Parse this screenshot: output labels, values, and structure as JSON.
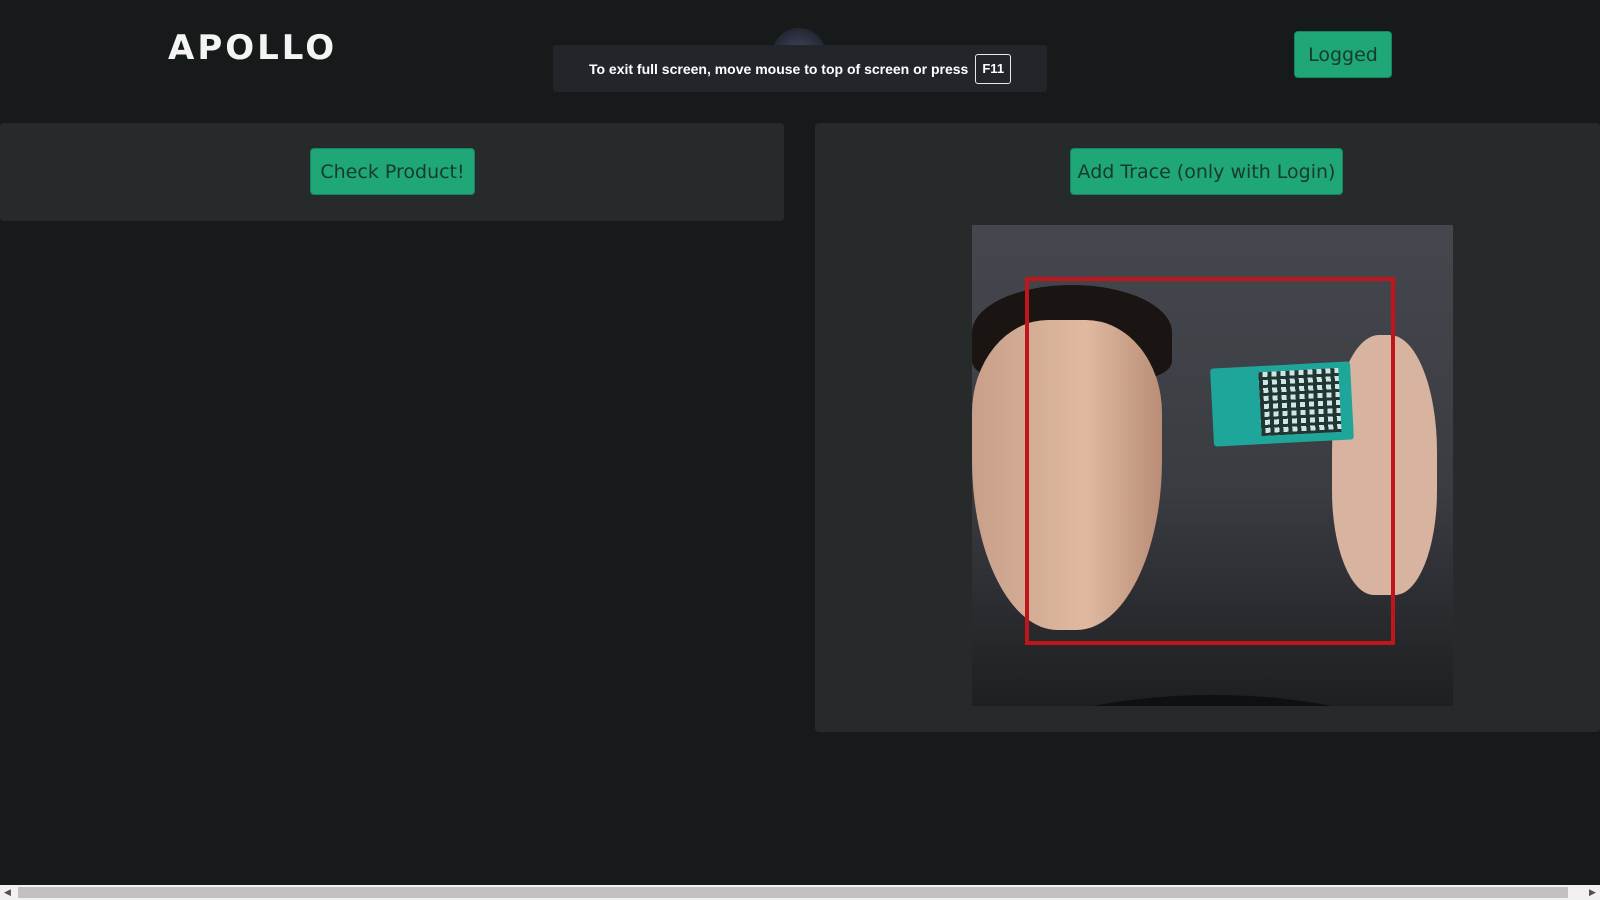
{
  "header": {
    "logo": "APOLLO",
    "logged_label": "Logged"
  },
  "fullscreen_toast": {
    "message": "To exit full screen, move mouse to top of screen or press",
    "key": "F11"
  },
  "left_panel": {
    "button_label": "Check Product!"
  },
  "right_panel": {
    "button_label": "Add Trace (only with Login)"
  },
  "colors": {
    "background": "#171a1a",
    "panel": "#262a2a",
    "accent_button": "#1fa777",
    "detection_box": "#c0161b"
  },
  "icons": {
    "scroll_left": "scroll-left-arrow-icon",
    "scroll_right": "scroll-right-arrow-icon"
  }
}
